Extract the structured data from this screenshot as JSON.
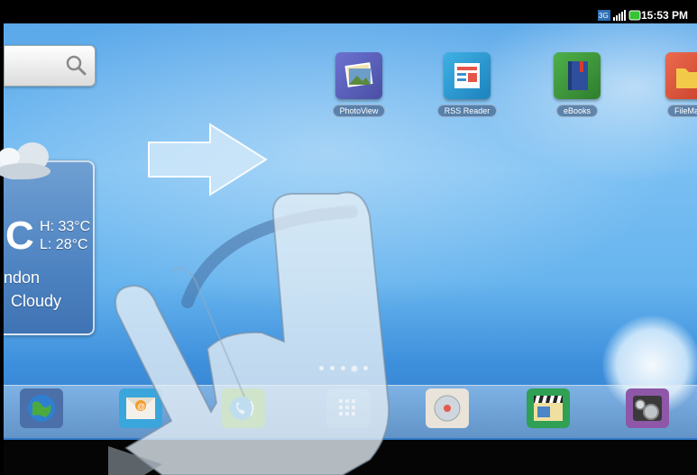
{
  "status_bar": {
    "time": "15:53 PM",
    "icons": [
      "3g-icon",
      "signal-icon",
      "battery-icon"
    ]
  },
  "search_widget": {
    "icon": "search-icon"
  },
  "weather": {
    "high": "H: 33°C",
    "low": "L: 28°C",
    "city": "ndon",
    "condition": "Cloudy",
    "icon": "cloud-icon"
  },
  "apps": [
    {
      "label": "PhotoView",
      "icon": "photo-icon",
      "color": "#5a5fb8"
    },
    {
      "label": "RSS Reader",
      "icon": "rss-icon",
      "color": "#2a9ad3"
    },
    {
      "label": "eBooks",
      "icon": "book-icon",
      "color": "#3c9a3a"
    },
    {
      "label": "FileMan",
      "icon": "folder-icon",
      "color": "#d8553b"
    }
  ],
  "dock": [
    {
      "name": "browser",
      "icon": "globe-icon"
    },
    {
      "name": "email",
      "icon": "mail-icon"
    },
    {
      "name": "phone",
      "icon": "phone-icon"
    },
    {
      "name": "all-apps",
      "icon": "apps-grid-icon"
    },
    {
      "name": "music",
      "icon": "music-icon"
    },
    {
      "name": "video",
      "icon": "clapper-icon"
    },
    {
      "name": "settings",
      "icon": "settings-icon"
    }
  ],
  "page_indicator": {
    "pages": 5,
    "current": 4
  },
  "gesture": {
    "type": "swipe-right"
  }
}
